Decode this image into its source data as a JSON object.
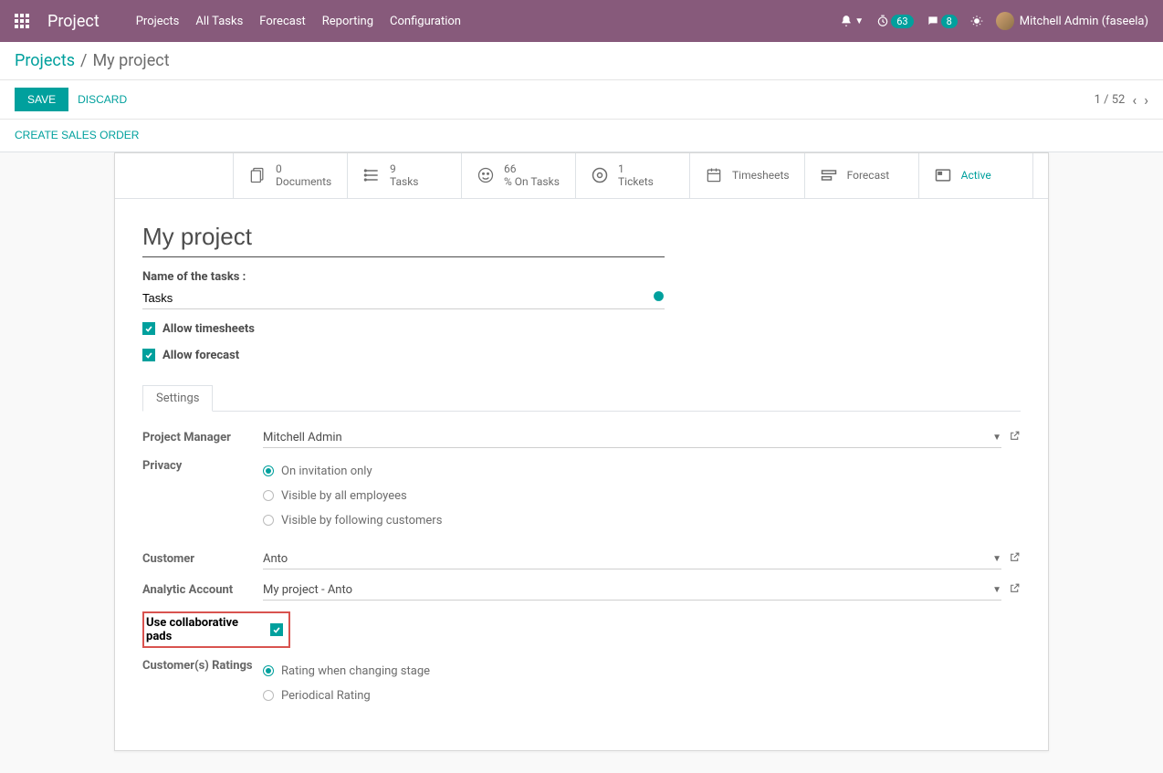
{
  "nav": {
    "brand": "Project",
    "items": [
      "Projects",
      "All Tasks",
      "Forecast",
      "Reporting",
      "Configuration"
    ],
    "timer_badge": "63",
    "chat_badge": "8",
    "user": "Mitchell Admin (faseela)"
  },
  "breadcrumb": {
    "root": "Projects",
    "current": "My project"
  },
  "actions": {
    "save": "SAVE",
    "discard": "DISCARD",
    "create_so": "CREATE SALES ORDER"
  },
  "pager": {
    "pos": "1",
    "total": "52"
  },
  "stat_buttons": [
    {
      "val": "0",
      "label": "Documents"
    },
    {
      "val": "9",
      "label": "Tasks"
    },
    {
      "val": "66",
      "label": "% On Tasks"
    },
    {
      "val": "1",
      "label": "Tickets"
    },
    {
      "val": "",
      "label": "Timesheets"
    },
    {
      "val": "",
      "label": "Forecast"
    },
    {
      "val": "",
      "label": "Active"
    }
  ],
  "form": {
    "title": "My project",
    "name_of_tasks_label": "Name of the tasks :",
    "name_of_tasks": "Tasks",
    "allow_timesheets": "Allow timesheets",
    "allow_forecast": "Allow forecast"
  },
  "tab": {
    "settings": "Settings"
  },
  "settings": {
    "pm_label": "Project Manager",
    "pm_value": "Mitchell Admin",
    "privacy_label": "Privacy",
    "privacy_opts": [
      "On invitation only",
      "Visible by all employees",
      "Visible by following customers"
    ],
    "customer_label": "Customer",
    "customer_value": "Anto",
    "analytic_label": "Analytic Account",
    "analytic_value": "My project - Anto",
    "pads_label": "Use collaborative pads",
    "ratings_label": "Customer(s) Ratings",
    "ratings_opts": [
      "Rating when changing stage",
      "Periodical Rating"
    ]
  }
}
